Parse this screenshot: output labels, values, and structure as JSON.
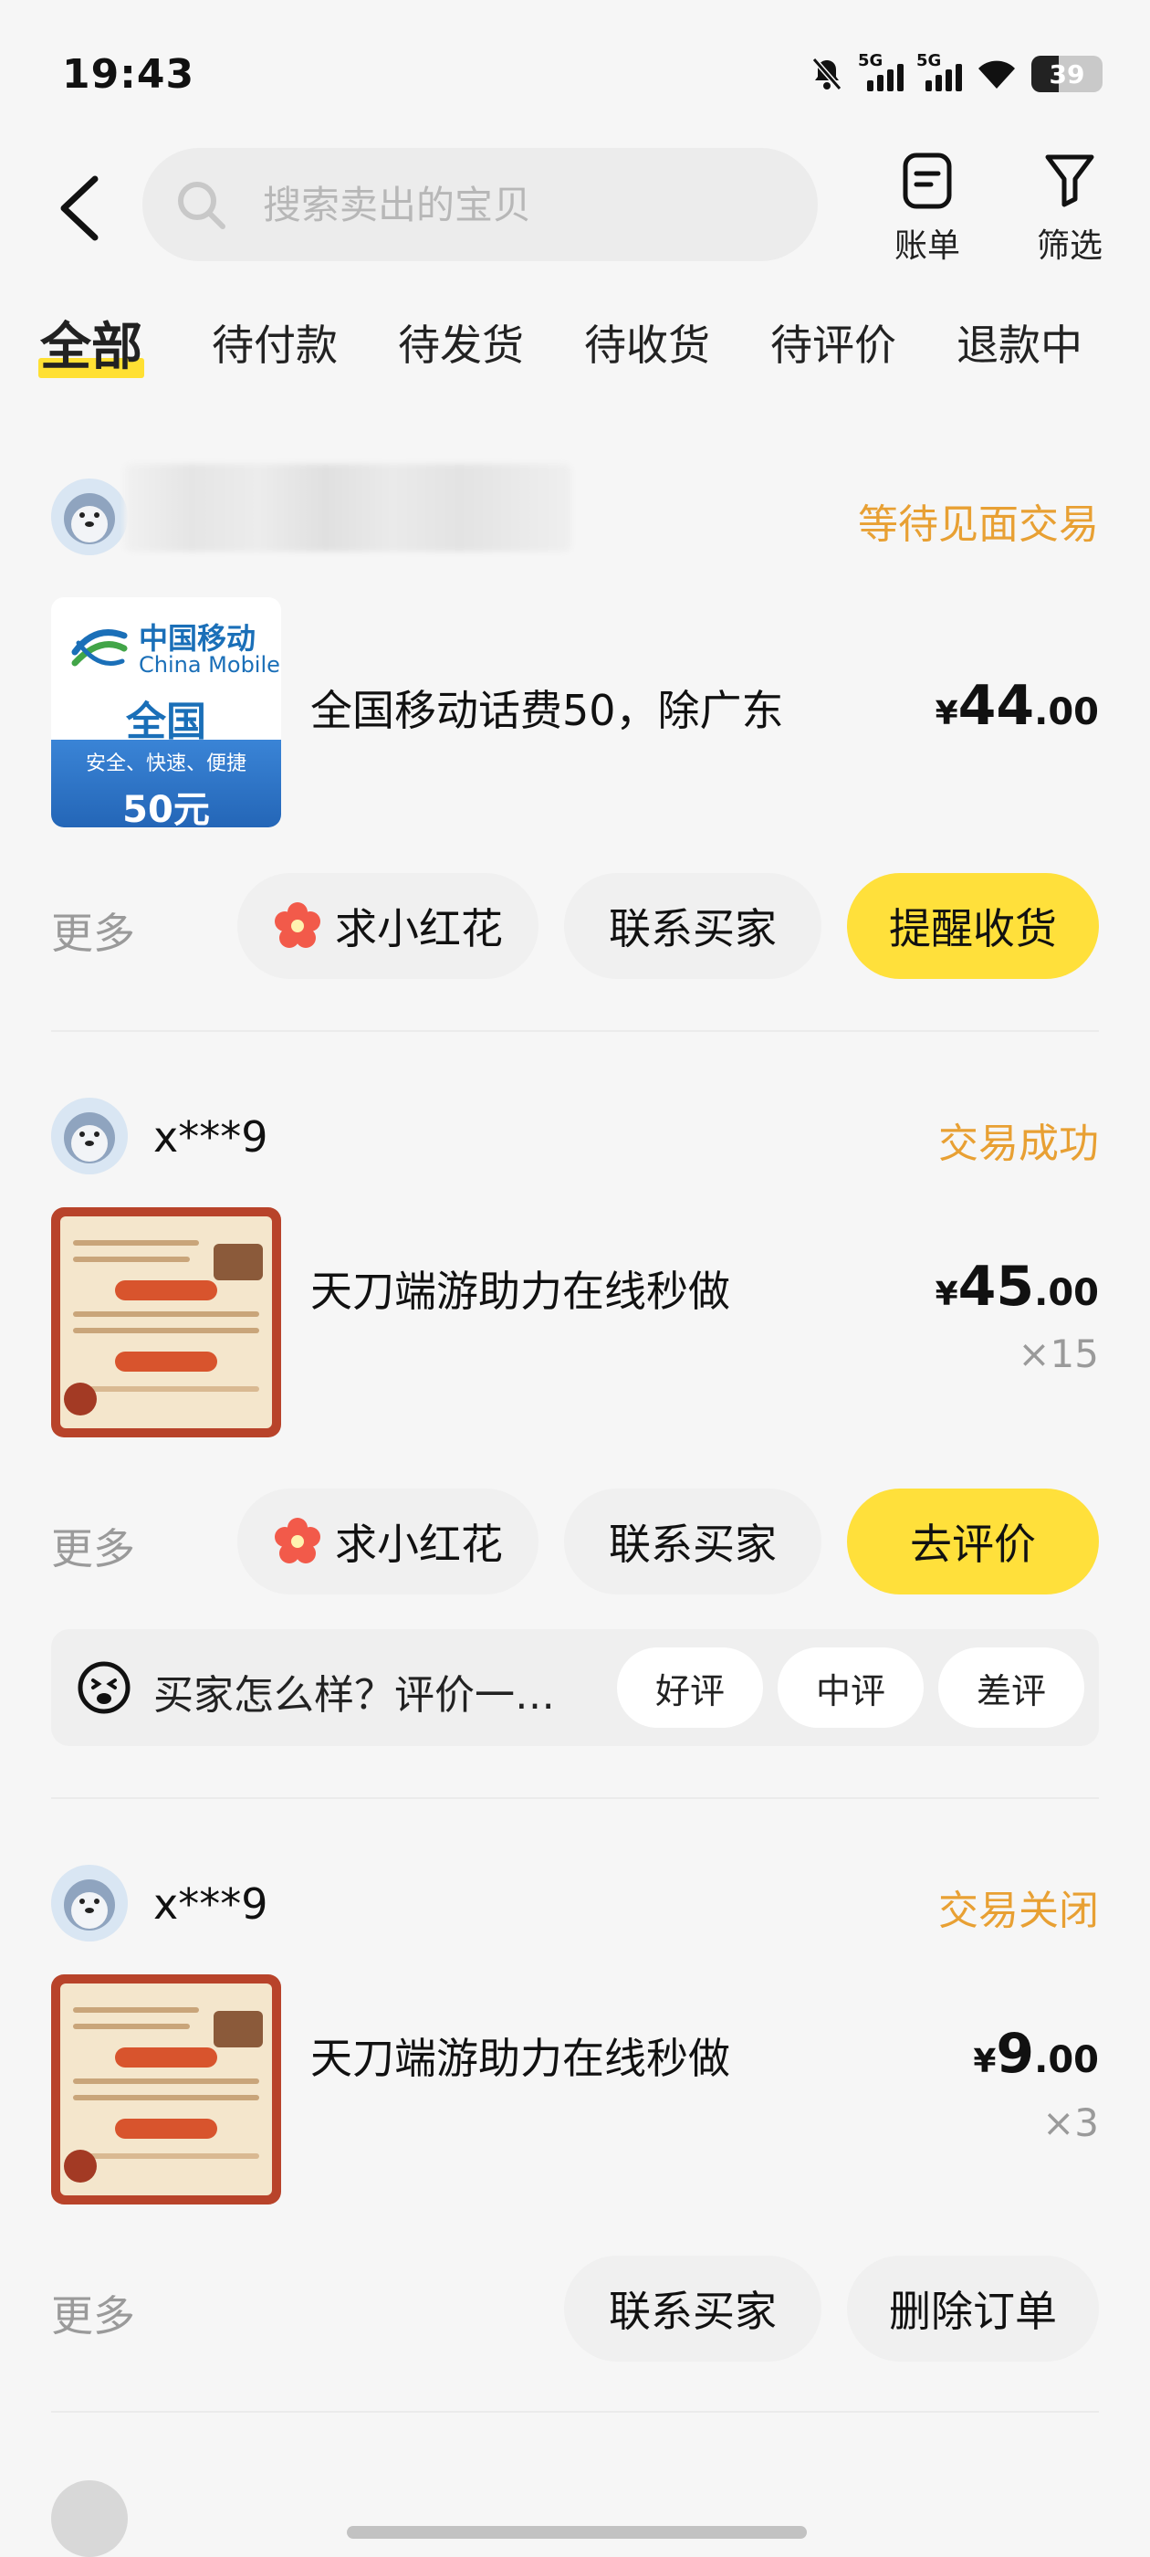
{
  "status_bar": {
    "time": "19:43",
    "signal1_label": "5G",
    "signal2_label": "5G",
    "battery_level": "39",
    "battery_fraction": 0.39
  },
  "header": {
    "search_placeholder": "搜索卖出的宝贝",
    "bill_label": "账单",
    "filter_label": "筛选"
  },
  "tabs": [
    "全部",
    "待付款",
    "待发货",
    "待收货",
    "待评价",
    "退款中"
  ],
  "orders": [
    {
      "buyer": "",
      "status": "等待见面交易",
      "title": "全国移动话费50，除广东",
      "price_currency": "¥",
      "price_int": "44",
      "price_dec": ".00",
      "quantity": "",
      "thumb": {
        "brand_cn": "中国移动",
        "brand_en": "China Mobile",
        "region": "全国",
        "slogan": "安全、快速、便捷",
        "amount": "50元"
      },
      "more": "更多",
      "actions": [
        "求小红花",
        "联系买家",
        "提醒收货"
      ]
    },
    {
      "buyer": "x***9",
      "status": "交易成功",
      "title": "天刀端游助力在线秒做",
      "price_currency": "¥",
      "price_int": "45",
      "price_dec": ".00",
      "quantity": "×15",
      "more": "更多",
      "actions": [
        "求小红花",
        "联系买家",
        "去评价"
      ],
      "review": {
        "prompt": "买家怎么样？评价一…",
        "options": [
          "好评",
          "中评",
          "差评"
        ]
      }
    },
    {
      "buyer": "x***9",
      "status": "交易关闭",
      "title": "天刀端游助力在线秒做",
      "price_currency": "¥",
      "price_int": "9",
      "price_dec": ".00",
      "quantity": "×3",
      "more": "更多",
      "actions": [
        "联系买家",
        "删除订单"
      ]
    }
  ],
  "colors": {
    "accent_yellow": "#ffe03b",
    "status_orange": "#e8a033",
    "flower_red": "#f25a4a",
    "china_mobile_blue": "#1a6fb8"
  },
  "icons": [
    "back-arrow-icon",
    "search-icon",
    "bill-icon",
    "filter-icon",
    "flower-icon",
    "smile-face-icon",
    "avatar-seal-icon"
  ]
}
